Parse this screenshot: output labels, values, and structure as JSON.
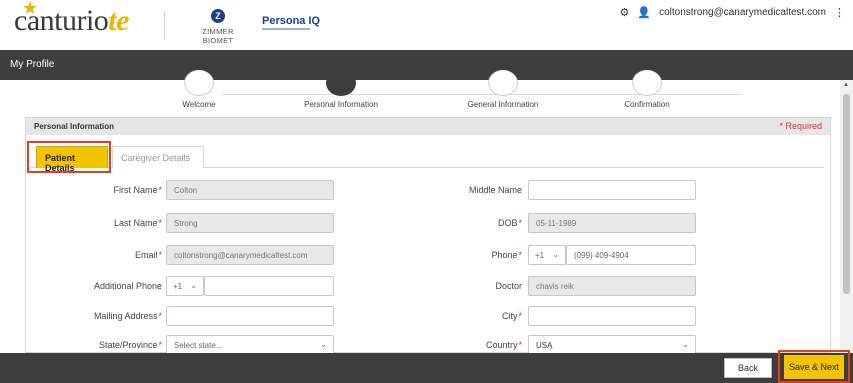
{
  "header": {
    "logo_text": "canturio",
    "logo_suffix": "te",
    "zimmer_text": "ZIMMER BIOMET",
    "zimmer_mark": "Z",
    "persona_text": "Persona",
    "persona_iq": "IQ",
    "user_email": "coltonstrong@canarymedicaltest.com",
    "gear_icon": "gear-icon",
    "user_icon": "user-icon",
    "more_icon": "more-vertical-icon"
  },
  "page_title": "My Profile",
  "stepper": {
    "steps": [
      {
        "label": "Welcome"
      },
      {
        "label": "Personal Information"
      },
      {
        "label": "General Information"
      },
      {
        "label": "Confirmation"
      }
    ],
    "active_index": 1
  },
  "panel": {
    "title": "Personal Information",
    "required_note": "* Required",
    "tabs": [
      {
        "label": "Patient Details"
      },
      {
        "label": "Caregiver Details"
      }
    ]
  },
  "form": {
    "first_name": {
      "label": "First Name",
      "value": "Colton"
    },
    "middle_name": {
      "label": "Middle Name",
      "value": ""
    },
    "last_name": {
      "label": "Last Name",
      "value": "Strong"
    },
    "dob": {
      "label": "DOB",
      "value": "05-11-1989"
    },
    "email": {
      "label": "Email",
      "value": "coltonstrong@canarymedicaltest.com"
    },
    "phone": {
      "label": "Phone",
      "country_code": "+1",
      "value": "(099) 409-4904"
    },
    "additional_phone": {
      "label": "Additional Phone",
      "country_code": "+1",
      "value": ""
    },
    "doctor": {
      "label": "Doctor",
      "value": "chavis reik"
    },
    "mailing_address": {
      "label": "Mailing Address",
      "value": ""
    },
    "city": {
      "label": "City",
      "value": ""
    },
    "state": {
      "label": "State/Province",
      "value": "Select state..."
    },
    "country": {
      "label": "Country",
      "value": "USA"
    }
  },
  "footer": {
    "back_label": "Back",
    "save_label": "Save & Next"
  },
  "colors": {
    "accent": "#f5c400",
    "dark": "#3d3d3d",
    "required": "#e03030",
    "highlight": "#e04020"
  }
}
